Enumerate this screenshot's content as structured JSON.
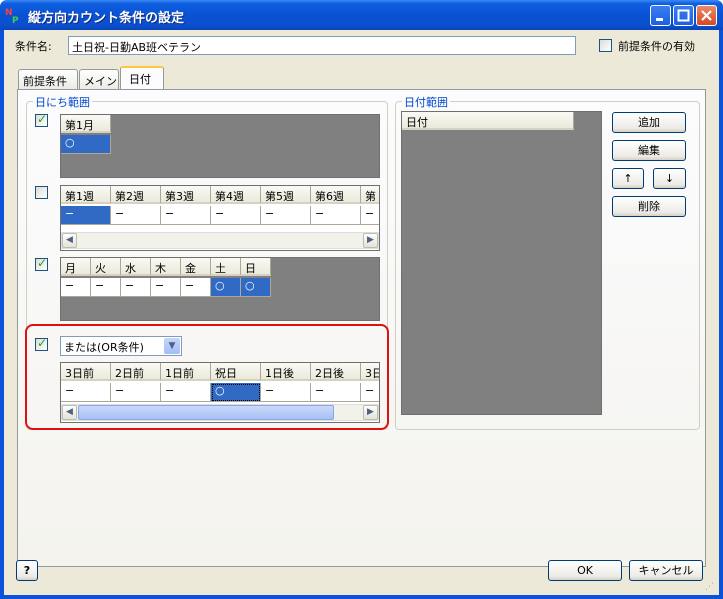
{
  "window": {
    "title": "縦方向カウント条件の設定"
  },
  "header": {
    "condition_label": "条件名:",
    "condition_value": "土日祝-日勤AB班ベテラン",
    "prereq_enabled_label": "前提条件の有効"
  },
  "tabs": [
    {
      "label": "前提条件",
      "active": false
    },
    {
      "label": "メイン",
      "active": false
    },
    {
      "label": "日付",
      "active": true
    }
  ],
  "day_range": {
    "title": "日にち範囲",
    "month_grid": {
      "headers": [
        "第1月"
      ],
      "values": [
        "○"
      ],
      "checked": true
    },
    "week_grid": {
      "headers": [
        "第1週",
        "第2週",
        "第3週",
        "第4週",
        "第5週",
        "第6週",
        "第"
      ],
      "values": [
        "−",
        "−",
        "−",
        "−",
        "−",
        "−",
        "−"
      ],
      "checked": false
    },
    "weekday_grid": {
      "headers": [
        "月",
        "火",
        "水",
        "木",
        "金",
        "土",
        "日"
      ],
      "values": [
        "−",
        "−",
        "−",
        "−",
        "−",
        "○",
        "○"
      ],
      "checked": true
    },
    "holiday_grid": {
      "combo_value": "または(OR条件)",
      "headers": [
        "3日前",
        "2日前",
        "1日前",
        "祝日",
        "1日後",
        "2日後",
        "3日"
      ],
      "values": [
        "−",
        "−",
        "−",
        "○",
        "−",
        "−",
        "−"
      ],
      "checked": true
    }
  },
  "date_range": {
    "title": "日付範囲",
    "column_header": "日付"
  },
  "buttons": {
    "add": "追加",
    "edit": "編集",
    "up": "↑",
    "down": "↓",
    "delete": "削除",
    "ok": "OK",
    "cancel": "キャンセル",
    "help": "?"
  },
  "colors": {
    "titlebar": "#0a52d4",
    "selection": "#316ac5",
    "highlight_border": "#e01010",
    "group_title": "#0046d5"
  }
}
